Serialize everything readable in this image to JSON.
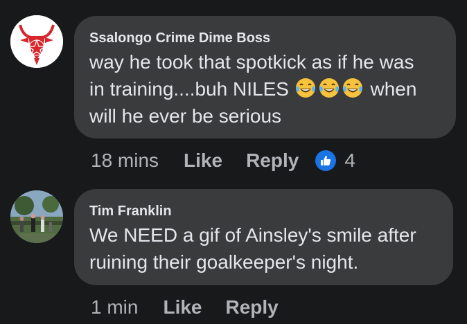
{
  "comments": [
    {
      "author": "Ssalongo Crime Dime Boss",
      "text_line1": "way he took that spotkick as if he was",
      "text_line2_before": "in training....buh NILES",
      "text_line2_after": "when",
      "text_line3": "will he ever be serious",
      "emojis": [
        "laughing-tears-emoji",
        "laughing-tears-emoji",
        "laughing-tears-emoji"
      ],
      "time": "18 mins",
      "like_label": "Like",
      "reply_label": "Reply",
      "reaction_icon": "thumbs-up-icon",
      "reaction_count": "4"
    },
    {
      "author": "Tim Franklin",
      "text_line1": "We NEED a gif of Ainsley's smile after",
      "text_line2": "ruining their goalkeeper's night.",
      "time": "1 min",
      "like_label": "Like",
      "reply_label": "Reply"
    }
  ],
  "colors": {
    "background": "#18191a",
    "bubble": "#3a3b3c",
    "text": "#e4e6eb",
    "secondary_text": "#b0b3b8",
    "like_blue": "#1b74e4"
  }
}
